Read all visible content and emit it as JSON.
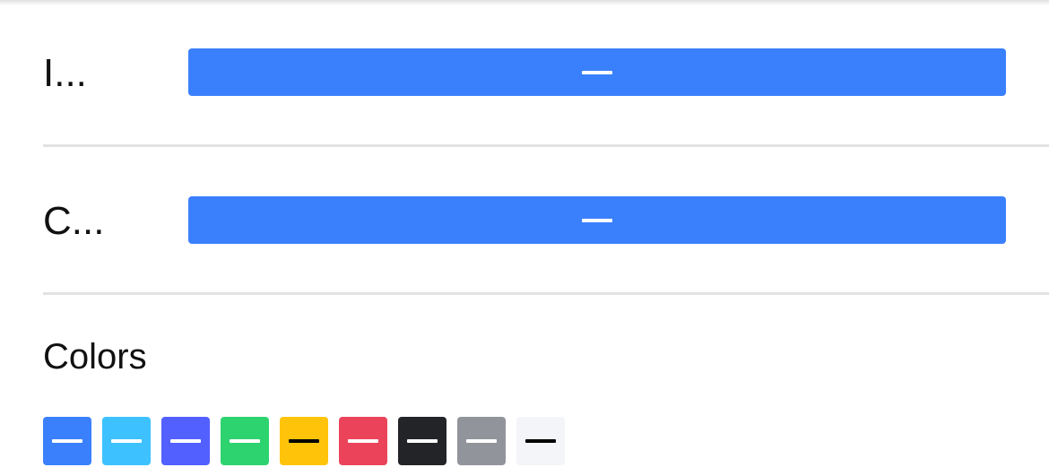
{
  "rows": [
    {
      "label": "I...",
      "button_color": "#3a80fc"
    },
    {
      "label": "C...",
      "button_color": "#3a80fc"
    }
  ],
  "colors_section": {
    "title": "Colors",
    "swatches": [
      {
        "name": "primary",
        "color": "#3a80fc",
        "dash_color": "#ffffff"
      },
      {
        "name": "secondary",
        "color": "#3dc2ff",
        "dash_color": "#ffffff"
      },
      {
        "name": "tertiary",
        "color": "#5260ff",
        "dash_color": "#ffffff"
      },
      {
        "name": "success",
        "color": "#2dd36f",
        "dash_color": "#ffffff"
      },
      {
        "name": "warning",
        "color": "#ffc409",
        "dash_color": "#000000"
      },
      {
        "name": "danger",
        "color": "#eb445a",
        "dash_color": "#ffffff"
      },
      {
        "name": "dark",
        "color": "#222428",
        "dash_color": "#ffffff"
      },
      {
        "name": "medium",
        "color": "#92949c",
        "dash_color": "#ffffff"
      },
      {
        "name": "light",
        "color": "#f4f5f8",
        "dash_color": "#000000"
      }
    ]
  }
}
